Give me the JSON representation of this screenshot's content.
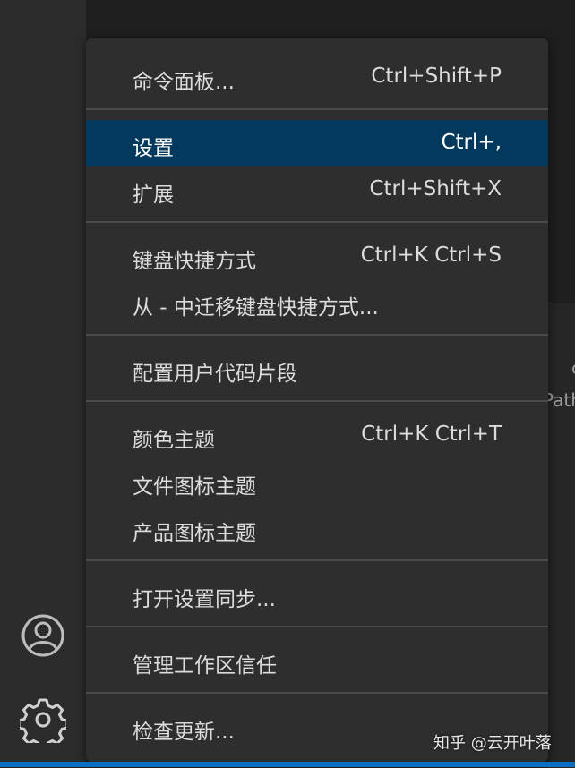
{
  "menu": {
    "items": [
      {
        "label": "命令面板...",
        "shortcut": "Ctrl+Shift+P"
      },
      {
        "label": "设置",
        "shortcut": "Ctrl+,"
      },
      {
        "label": "扩展",
        "shortcut": "Ctrl+Shift+X"
      },
      {
        "label": "键盘快捷方式",
        "shortcut": "Ctrl+K Ctrl+S"
      },
      {
        "label": "从 - 中迁移键盘快捷方式...",
        "shortcut": ""
      },
      {
        "label": "配置用户代码片段",
        "shortcut": ""
      },
      {
        "label": "颜色主题",
        "shortcut": "Ctrl+K Ctrl+T"
      },
      {
        "label": "文件图标主题",
        "shortcut": ""
      },
      {
        "label": "产品图标主题",
        "shortcut": ""
      },
      {
        "label": "打开设置同步...",
        "shortcut": ""
      },
      {
        "label": "管理工作区信任",
        "shortcut": ""
      },
      {
        "label": "检查更新...",
        "shortcut": ""
      }
    ],
    "active_item": "设置"
  },
  "activity_bar": {
    "icons": [
      "account-icon",
      "gear-icon"
    ]
  },
  "editor_peek": {
    "line1": "c",
    "line2": "Path"
  },
  "watermark": "知乎 @云开叶落",
  "colors": {
    "menu_bg": "#2e2e2e",
    "active_bg": "#04395e",
    "status_bar": "#0b6fc3"
  }
}
